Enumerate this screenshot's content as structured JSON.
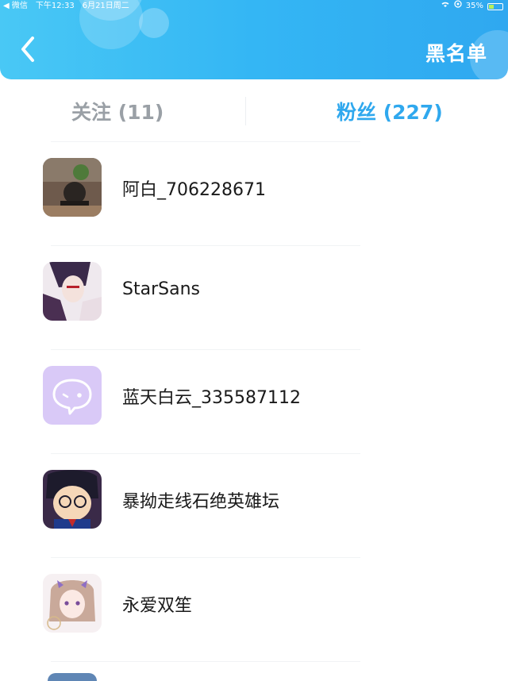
{
  "status_bar": {
    "carrier": "◀ 微信",
    "time": "下午12:33",
    "date": "6月21日周二",
    "battery": "35%",
    "battery_level": 0.35
  },
  "header": {
    "back_icon": "chevron-left-icon",
    "blacklist_label": "黑名单"
  },
  "tabs": [
    {
      "label": "关注 (11)",
      "active": false
    },
    {
      "label": "粉丝 (227)",
      "active": true
    }
  ],
  "colors": {
    "accent": "#2fa8ee",
    "header_start": "#49c8f5",
    "header_end": "#2fa8f0",
    "inactive_tab": "#9aa0a6"
  },
  "fans": [
    {
      "name": "阿白_706228671",
      "avatar": "photo-person-avatar"
    },
    {
      "name": "StarSans",
      "avatar": "anime-boy-avatar"
    },
    {
      "name": "蓝天白云_335587112",
      "avatar": "chat-bubble-avatar"
    },
    {
      "name": "暴拗走线石绝英雄坛",
      "avatar": "anime-detective-avatar"
    },
    {
      "name": "永爱双笙",
      "avatar": "anime-girl-avatar"
    }
  ]
}
